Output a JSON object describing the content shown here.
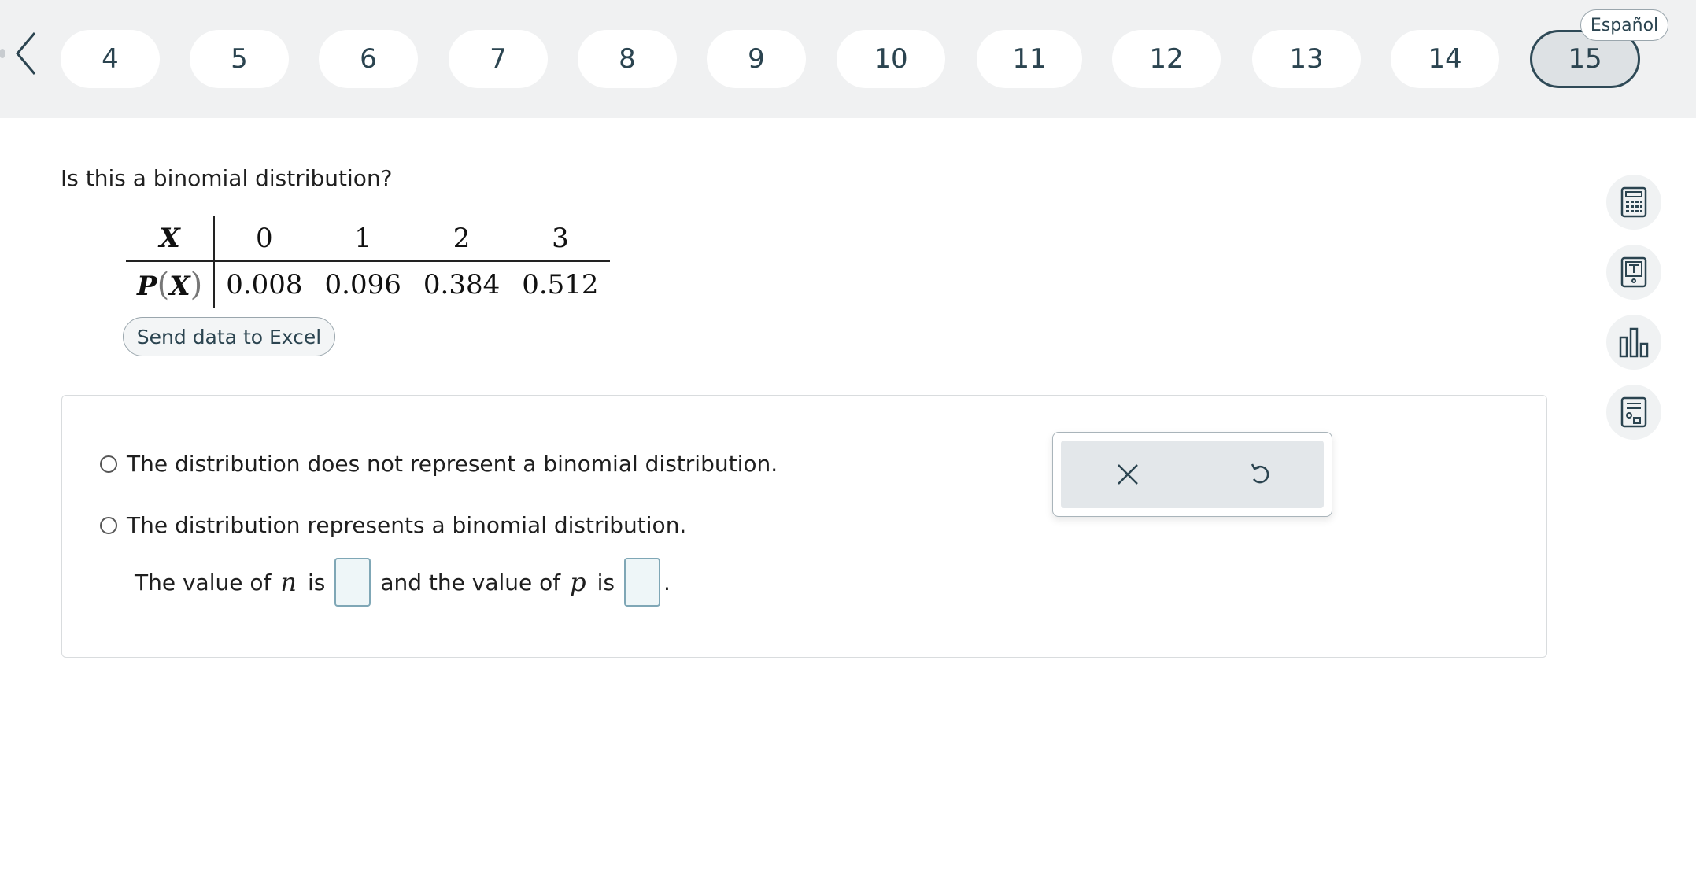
{
  "nav": {
    "questions": [
      "4",
      "5",
      "6",
      "7",
      "8",
      "9",
      "10",
      "11",
      "12",
      "13",
      "14",
      "15"
    ],
    "active": "15",
    "language_label": "Español"
  },
  "question": {
    "text": "Is this a binomial distribution?",
    "table": {
      "x_header": "X",
      "p_header_p": "P",
      "p_header_x": "X",
      "p_header_open": "(",
      "p_header_close": ")",
      "x_values": [
        "0",
        "1",
        "2",
        "3"
      ],
      "p_values": [
        "0.008",
        "0.096",
        "0.384",
        "0.512"
      ]
    },
    "excel_button": "Send data to Excel"
  },
  "answer": {
    "option1": "The distribution does not represent a binomial distribution.",
    "option2": "The distribution represents a binomial distribution.",
    "row_prefix": "The value of",
    "var_n": "n",
    "is1": "is",
    "middle": "and the value of",
    "var_p": "p",
    "is2": "is",
    "end": "."
  },
  "popup": {
    "clear_icon": "close-icon",
    "undo_icon": "undo-icon"
  },
  "tools": [
    "calculator-icon",
    "textbook-icon",
    "chart-icon",
    "formula-sheet-icon"
  ],
  "colors": {
    "nav_bg": "#f0f1f2",
    "accent": "#2f4a57",
    "input_bg": "#eef6f8",
    "input_border": "#7fa7b6"
  }
}
